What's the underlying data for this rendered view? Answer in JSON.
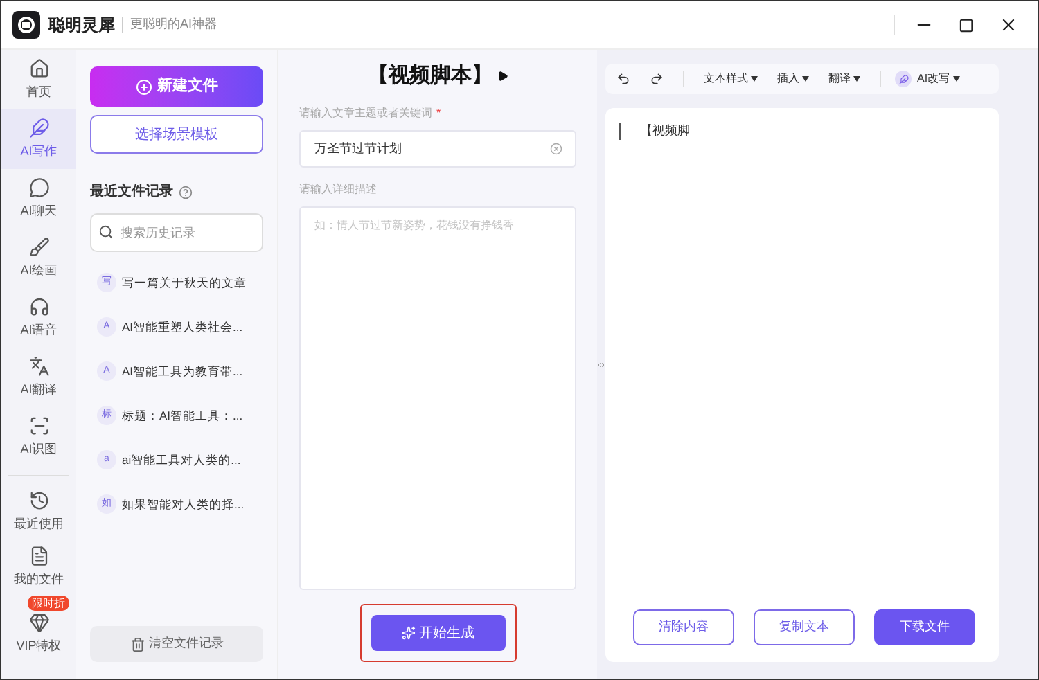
{
  "app": {
    "name": "聪明灵犀",
    "slogan": "更聪明的AI神器"
  },
  "nav": [
    {
      "label": "首页",
      "selected": false
    },
    {
      "label": "AI写作",
      "selected": true
    },
    {
      "label": "AI聊天",
      "selected": false
    },
    {
      "label": "AI绘画",
      "selected": false
    },
    {
      "label": "AI语音",
      "selected": false
    },
    {
      "label": "AI翻译",
      "selected": false
    },
    {
      "label": "AI识图",
      "selected": false
    }
  ],
  "nav_bottom": [
    {
      "label": "最近使用"
    },
    {
      "label": "我的文件"
    },
    {
      "label": "VIP特权",
      "badge": "限时折"
    }
  ],
  "left": {
    "new_button": "新建文件",
    "template_button": "选择场景模板",
    "recent_title": "最近文件记录",
    "search": {
      "placeholder": "搜索历史记录"
    },
    "files": [
      {
        "tag": "写",
        "title": "写一篇关于秋天的文章"
      },
      {
        "tag": "A",
        "title": "AI智能重塑人类社会..."
      },
      {
        "tag": "A",
        "title": "AI智能工具为教育带..."
      },
      {
        "tag": "标",
        "title": "标题：AI智能工具：..."
      },
      {
        "tag": "a",
        "title": "ai智能工具对人类的..."
      },
      {
        "tag": "如",
        "title": "如果智能对人类的择..."
      }
    ],
    "clear_button": "清空文件记录"
  },
  "middle": {
    "title": "【视频脚本】",
    "topic_label": "请输入文章主题或者关键词",
    "required_mark": "*",
    "topic_value": "万圣节过节计划",
    "desc_label": "请输入详细描述",
    "desc": {
      "placeholder": "如：情人节过节新姿势，花钱没有挣钱香"
    },
    "generate_button": "开始生成"
  },
  "right": {
    "toolbar": [
      "文本样式",
      "插入",
      "翻译"
    ],
    "ai_rewrite": "AI改写",
    "content": "【视频脚",
    "buttons": [
      {
        "label": "清除内容",
        "kind": "outline"
      },
      {
        "label": "复制文本",
        "kind": "outline"
      },
      {
        "label": "下载文件",
        "kind": "primary"
      }
    ]
  }
}
